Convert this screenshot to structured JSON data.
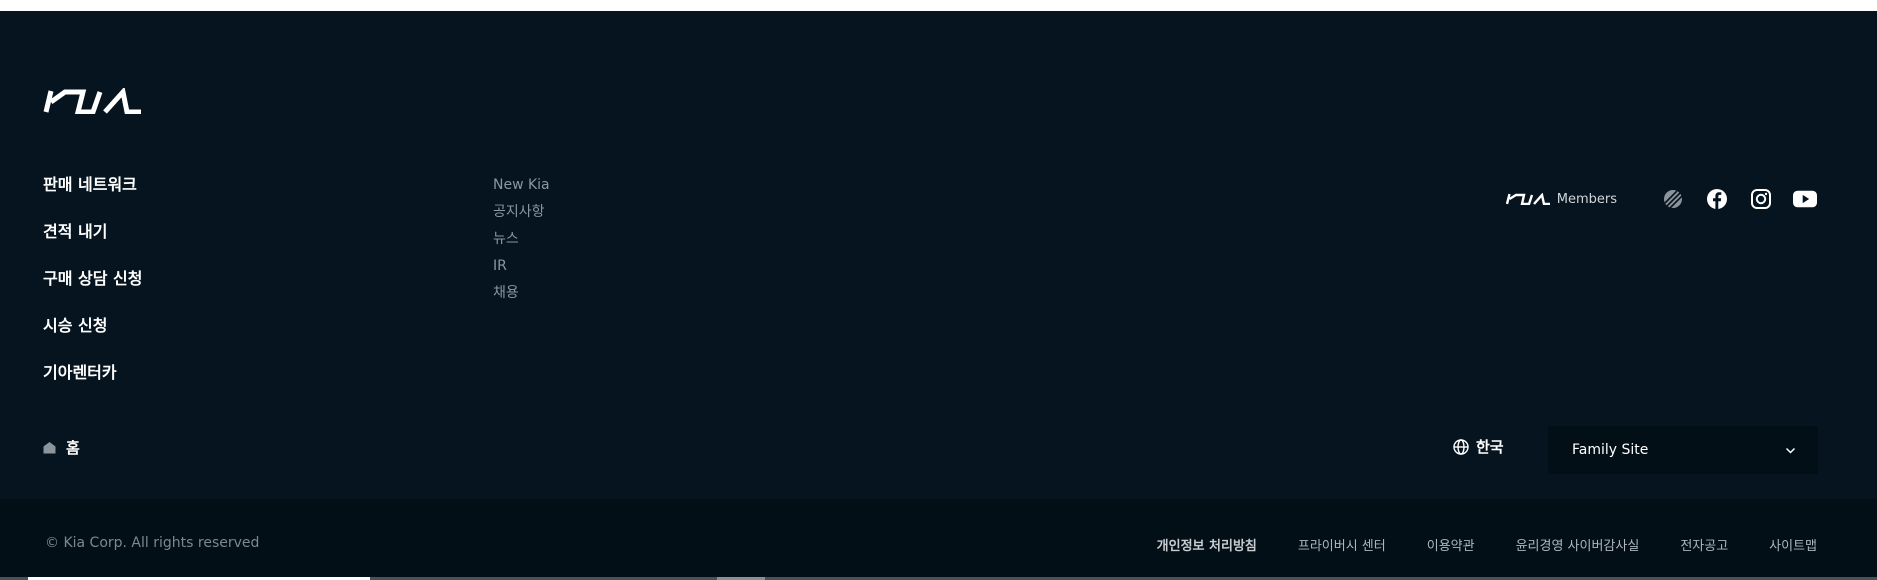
{
  "brand": {
    "logo_alt": "Kia"
  },
  "primary_nav": [
    {
      "label": "판매 네트워크"
    },
    {
      "label": "견적 내기"
    },
    {
      "label": "구매 상담 신청"
    },
    {
      "label": "시승 신청"
    },
    {
      "label": "기아렌터카"
    }
  ],
  "secondary_nav": [
    {
      "label": "New Kia"
    },
    {
      "label": "공지사항"
    },
    {
      "label": "뉴스"
    },
    {
      "label": "IR"
    },
    {
      "label": "채용"
    }
  ],
  "social": {
    "members_label": "Members",
    "icons": [
      "kia-members-icon",
      "striped-badge-icon",
      "facebook-icon",
      "instagram-icon",
      "youtube-icon"
    ]
  },
  "home": {
    "label": "홈",
    "icon": "home-icon"
  },
  "language": {
    "label": "한국",
    "icon": "globe-icon"
  },
  "family_site": {
    "label": "Family Site",
    "icon": "chevron-down-icon"
  },
  "copyright": "© Kia Corp. All rights reserved",
  "legal_links": [
    {
      "label": "개인정보 처리방침",
      "strong": true
    },
    {
      "label": "프라이버시 센터"
    },
    {
      "label": "이용약관"
    },
    {
      "label": "윤리경영 사이버감사실"
    },
    {
      "label": "전자공고"
    },
    {
      "label": "사이트맵"
    }
  ],
  "colors": {
    "footer_bg": "#05141f",
    "bottom_bar_bg": "#030f17",
    "text_primary": "#ffffff",
    "text_muted": "#8b969e"
  }
}
